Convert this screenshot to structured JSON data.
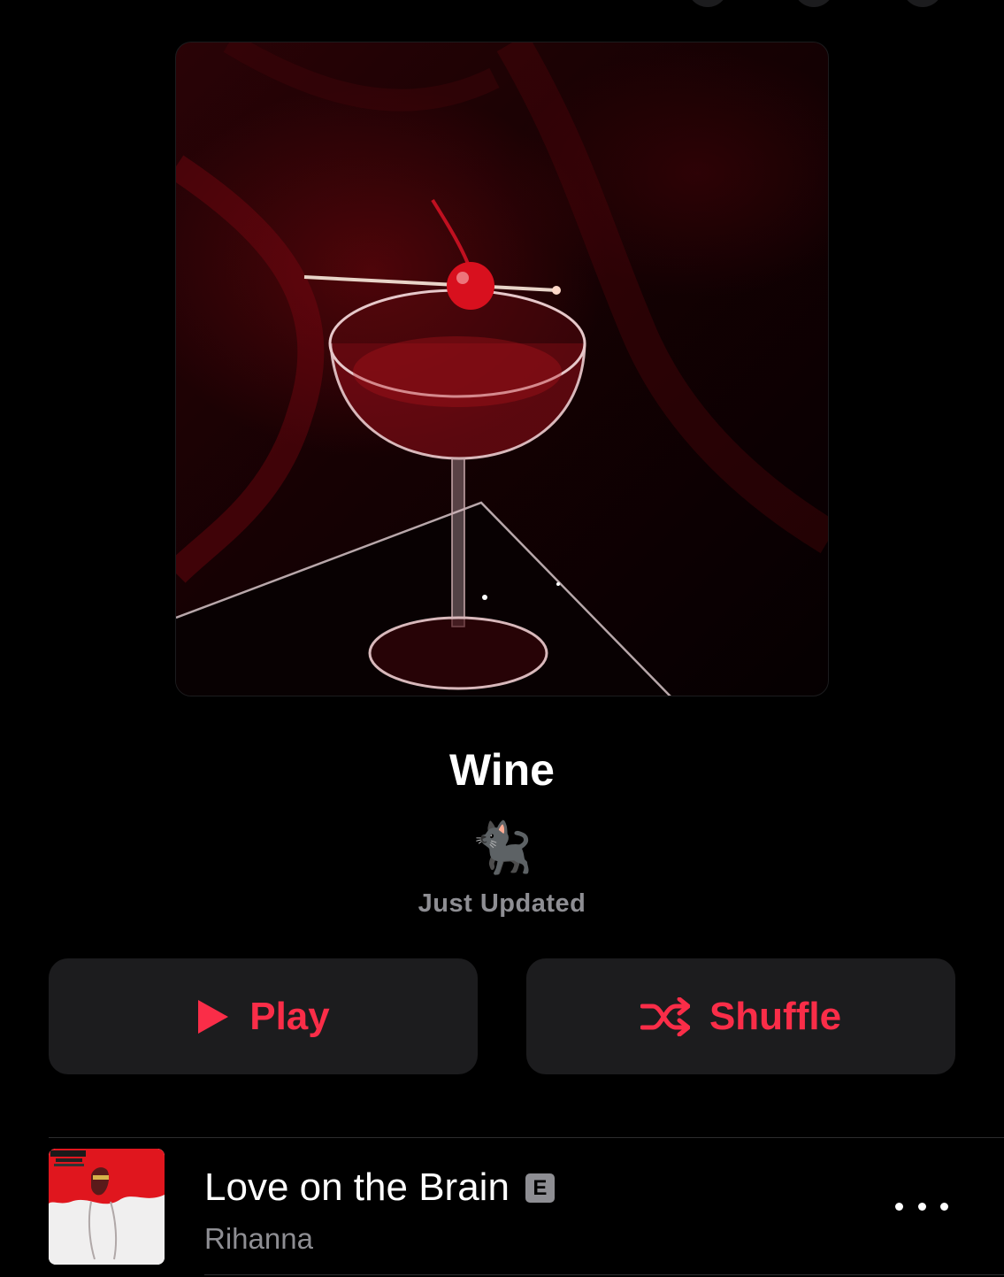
{
  "playlist": {
    "title": "Wine",
    "curator_glyph": "🐈‍⬛",
    "status": "Just Updated"
  },
  "actions": {
    "play_label": "Play",
    "shuffle_label": "Shuffle"
  },
  "tracks": [
    {
      "title": "Love on the Brain",
      "explicit_badge": "E",
      "artist": "Rihanna",
      "art_text": "RIHANNA"
    }
  ],
  "colors": {
    "accent": "#fa2d48",
    "secondary_text": "#8e8e93",
    "button_bg": "#1c1c1e"
  },
  "icons": [
    "play-icon",
    "shuffle-icon",
    "more-icon"
  ]
}
